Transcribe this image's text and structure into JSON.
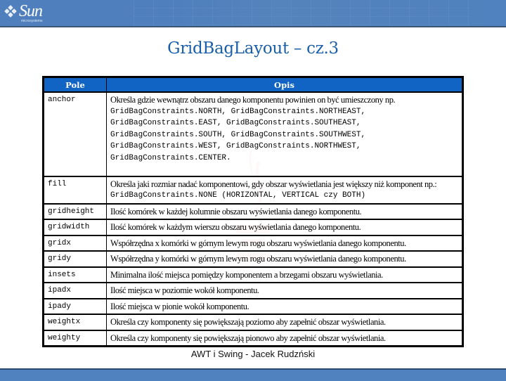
{
  "header": {
    "logo": {
      "name": "Sun",
      "subtitle": "microsystems",
      "icon": "sun-logo-icon"
    },
    "colors": {
      "bar": "#4f80bd",
      "title": "#1a5fa8",
      "table_header": "#1164c4"
    }
  },
  "slide": {
    "title": "GridBagLayout – cz.3"
  },
  "table": {
    "headers": {
      "field": "Pole",
      "description": "Opis"
    },
    "rows": [
      {
        "field": "anchor",
        "text": "Określa gdzie wewnątrz obszaru danego komponentu powinien on być umieszczony np.",
        "code_lines": [
          "GridBagConstraints.NORTH, GridBagConstraints.NORTHEAST,",
          "GridBagConstraints.EAST, GridBagConstraints.SOUTHEAST,",
          "GridBagConstraints.SOUTH, GridBagConstraints.SOUTHWEST,",
          "GridBagConstraints.WEST, GridBagConstraints.NORTHWEST,",
          "GridBagConstraints.CENTER."
        ]
      },
      {
        "field": "fill",
        "text": "Określa jaki rozmiar nadać komponentowi, gdy obszar wyświetlania jest większy niż komponent np.:",
        "code_inline": "GridBagConstraints.NONE (HORIZONTAL, VERTICAL czy BOTH)"
      },
      {
        "field": "gridheight",
        "text": "Ilość komórek w każdej kolumnie obszaru wyświetlania danego komponentu."
      },
      {
        "field": "gridwidth",
        "text": "Ilość komórek w każdym wierszu obszaru wyświetlania danego komponentu."
      },
      {
        "field": "gridx",
        "text": "Współrzędna x komórki w górnym lewym rogu obszaru wyświetlania danego komponentu."
      },
      {
        "field": "gridy",
        "text": "Współrzędna y komórki w górnym lewym rogu obszaru wyświetlania danego komponentu."
      },
      {
        "field": "insets",
        "text": "Minimalna ilość miejsca pomiędzy komponentem a brzegami obszaru wyświetlania."
      },
      {
        "field": "ipadx",
        "text": "Ilość miejsca w poziomie wokół komponentu."
      },
      {
        "field": "ipady",
        "text": "Ilość miejsca w pionie wokół komponentu."
      },
      {
        "field": "weightx",
        "text": "Określa czy komponenty się powiększają poziomo aby zapełnić obszar wyświetlania."
      },
      {
        "field": "weighty",
        "text": "Określa czy komponenty się powiększają pionowo aby zapełnić obszar wyświetlania."
      }
    ]
  },
  "footer": {
    "text": "AWT i Swing - Jacek Rudzński"
  }
}
